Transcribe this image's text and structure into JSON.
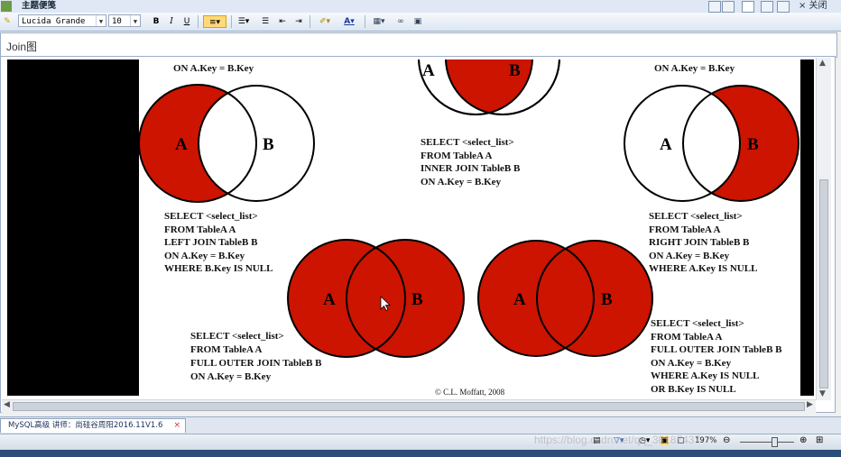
{
  "window": {
    "title": "主题便笺",
    "close_label": "× 关闭"
  },
  "toolbar": {
    "font_family": "Lucida Grande",
    "font_size": "10",
    "bold": "B",
    "italic": "I",
    "underline": "U",
    "font_color_label": "A",
    "accent": "#ffd97a"
  },
  "topic": {
    "title": "Join图"
  },
  "diagram": {
    "red": "#cc1400",
    "top_left_code": "ON A.Key = B.Key",
    "top_right_code": "ON A.Key = B.Key",
    "label_a": "A",
    "label_b": "B",
    "inner_join": [
      "SELECT <select_list>",
      "FROM TableA A",
      "INNER JOIN TableB B",
      "ON A.Key = B.Key"
    ],
    "left_join_null": [
      "SELECT <select_list>",
      "FROM TableA A",
      "LEFT JOIN TableB B",
      "ON A.Key = B.Key",
      "WHERE B.Key IS NULL"
    ],
    "right_join_null": [
      "SELECT <select_list>",
      "FROM TableA A",
      "RIGHT JOIN TableB B",
      "ON A.Key = B.Key",
      "WHERE A.Key IS NULL"
    ],
    "full_outer_join": [
      "SELECT <select_list>",
      "FROM TableA A",
      "FULL OUTER JOIN TableB B",
      "ON A.Key = B.Key"
    ],
    "full_outer_join_null": [
      "SELECT <select_list>",
      "FROM TableA A",
      "FULL OUTER JOIN TableB B",
      "ON A.Key = B.Key",
      "WHERE A.Key IS NULL",
      "OR B.Key IS NULL"
    ],
    "copyright": "© C.L. Moffatt, 2008"
  },
  "tabs": [
    {
      "label": "MySQL高级 讲师：尚硅谷周阳2016.11V1.6",
      "close": "×"
    }
  ],
  "status": {
    "zoom": "197%",
    "watermark": "https://blog.csdn.net/qq_38187437"
  }
}
